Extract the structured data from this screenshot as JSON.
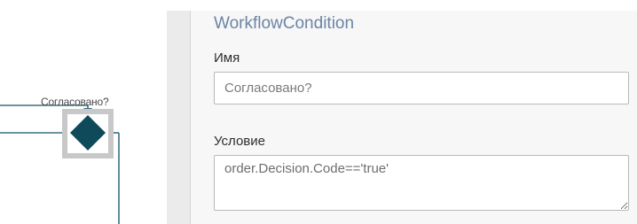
{
  "canvas": {
    "node_label": "Согласовано?",
    "line_color": "#3b7080",
    "node_color": "#0e4a5a",
    "selection_color": "#c8c8c8"
  },
  "panel": {
    "title": "WorkflowCondition",
    "title_color": "#6b84a4",
    "name_label": "Имя",
    "name_value": "Согласовано?",
    "condition_label": "Условие",
    "condition_value": "order.Decision.Code=='true'"
  }
}
